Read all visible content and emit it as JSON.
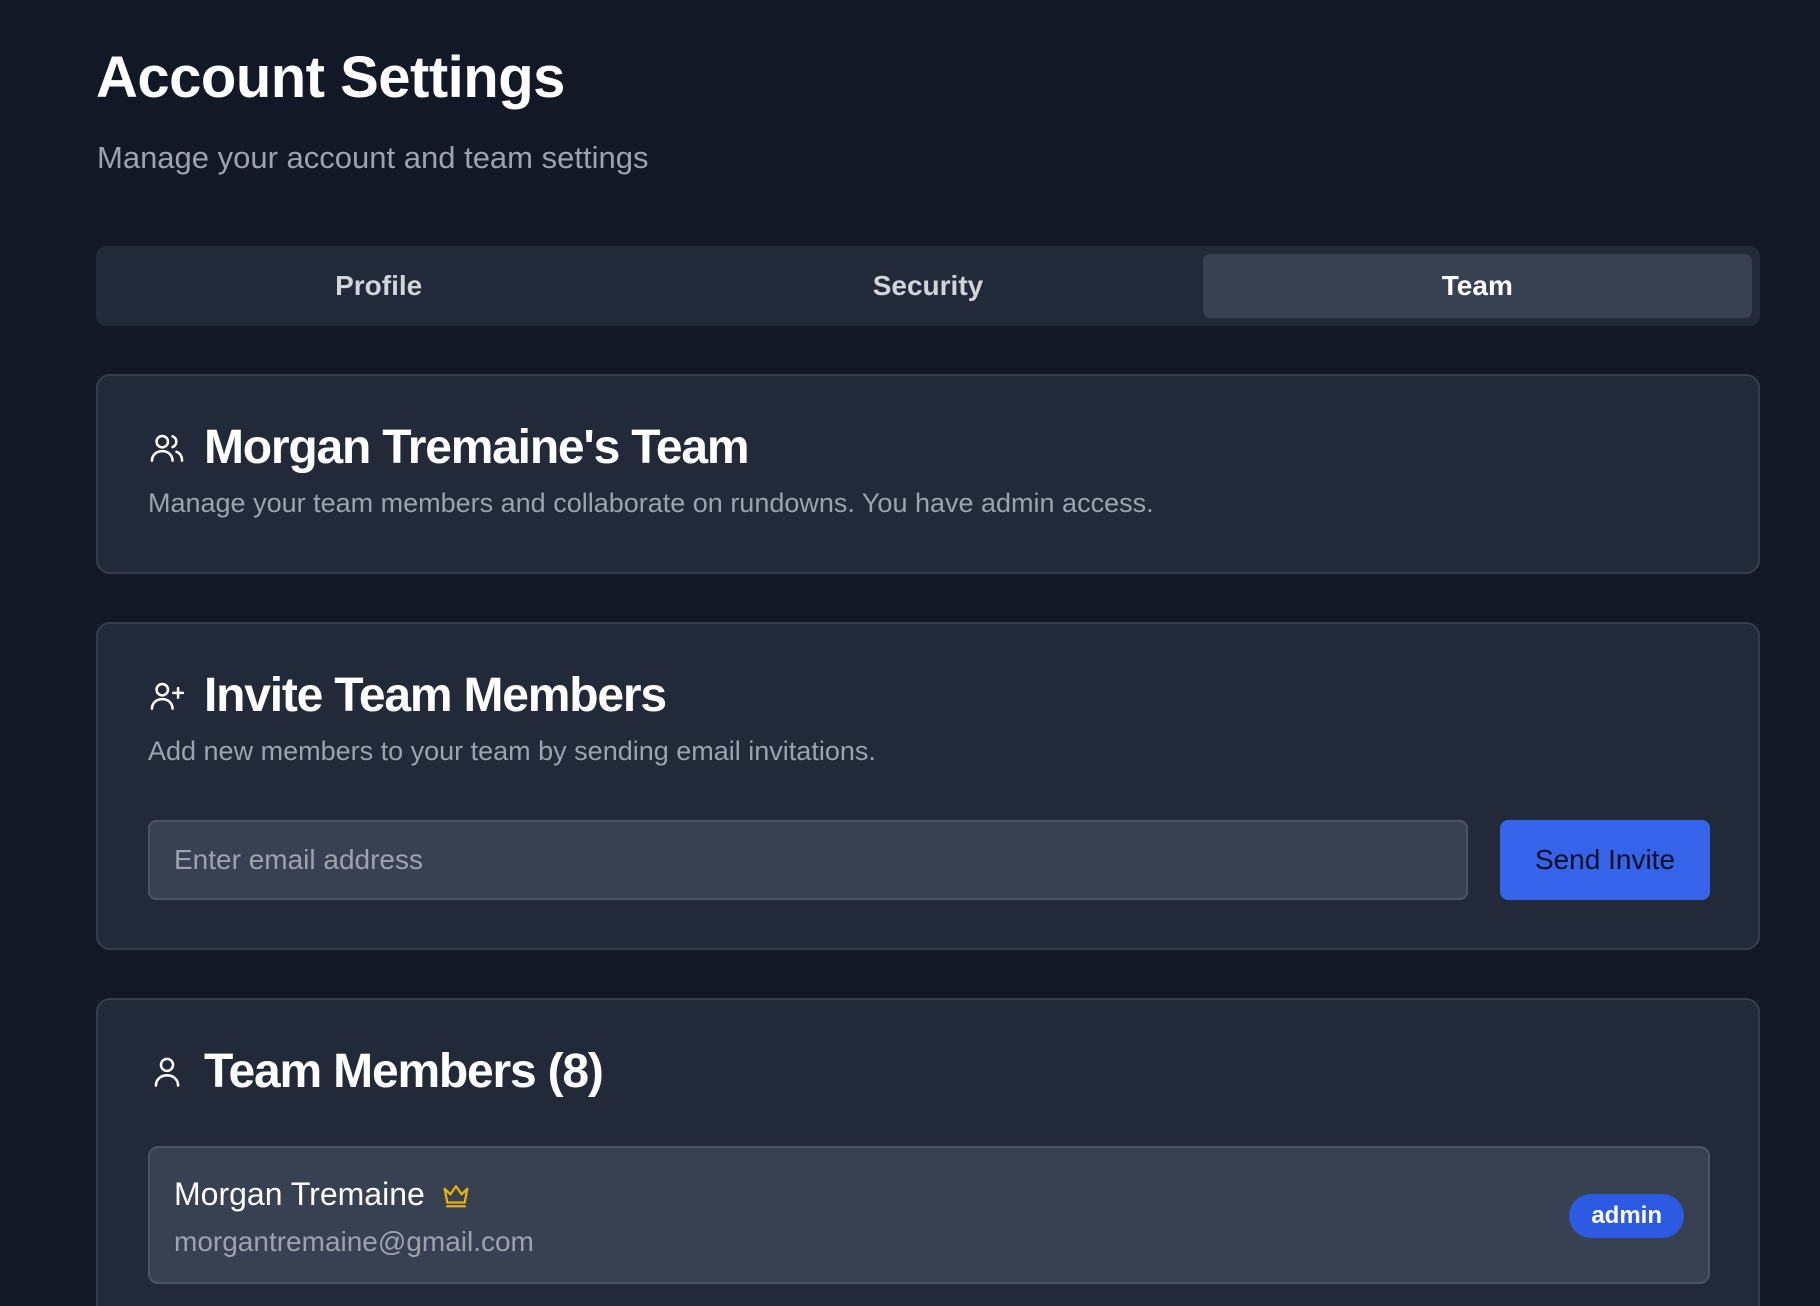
{
  "header": {
    "title": "Account Settings",
    "subtitle": "Manage your account and team settings"
  },
  "tabs": [
    {
      "label": "Profile",
      "active": false
    },
    {
      "label": "Security",
      "active": false
    },
    {
      "label": "Team",
      "active": true
    }
  ],
  "team_card": {
    "icon": "users-icon",
    "title": "Morgan Tremaine's Team",
    "description": "Manage your team members and collaborate on rundowns. You have admin access."
  },
  "invite_card": {
    "icon": "user-plus-icon",
    "title": "Invite Team Members",
    "description": "Add new members to your team by sending email invitations.",
    "email_placeholder": "Enter email address",
    "email_value": "",
    "send_label": "Send Invite"
  },
  "members_card": {
    "icon": "user-icon",
    "title": "Team Members (8)",
    "members": [
      {
        "name": "Morgan Tremaine",
        "owner_icon": "crown-icon",
        "email": "morgantremaine@gmail.com",
        "role": "admin"
      }
    ]
  },
  "colors": {
    "background": "#121826",
    "card": "#222938",
    "accent": "#3563e9",
    "crown": "#eab308"
  }
}
